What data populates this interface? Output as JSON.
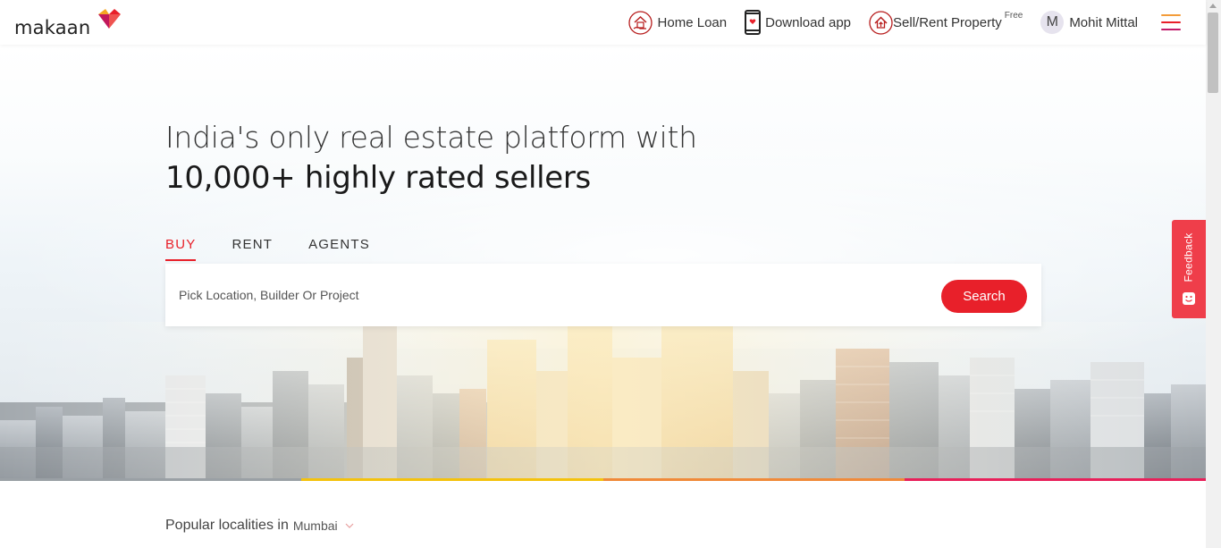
{
  "brand": {
    "name": "makaan"
  },
  "header": {
    "home_loan": "Home Loan",
    "download_app": "Download app",
    "sell_rent": "Sell/Rent Property",
    "sell_rent_badge": "Free",
    "user_initial": "M",
    "user_name": "Mohit Mittal"
  },
  "hero": {
    "headline_line1": "India's only real estate platform with",
    "headline_line2": "10,000+ highly rated sellers",
    "tabs": [
      {
        "label": "BUY",
        "active": true
      },
      {
        "label": "RENT",
        "active": false
      },
      {
        "label": "AGENTS",
        "active": false
      }
    ],
    "search": {
      "placeholder": "Pick Location, Builder Or Project",
      "value": "",
      "button": "Search"
    }
  },
  "feedback": {
    "label": "Feedback"
  },
  "popular": {
    "label": "Popular localities in",
    "city": "Mumbai"
  },
  "colors": {
    "accent": "#e8202a",
    "feedback_bg": "#ef3e4a",
    "bar": [
      "#f4c20d",
      "#f08a3a",
      "#e8202a"
    ],
    "hamburger": [
      "#f39c3a",
      "#e8202a",
      "#c21d6a"
    ]
  },
  "icons": [
    "home-loan-icon",
    "phone-icon",
    "sell-house-icon",
    "hamburger-icon",
    "chevron-down-icon",
    "feedback-face-icon"
  ]
}
